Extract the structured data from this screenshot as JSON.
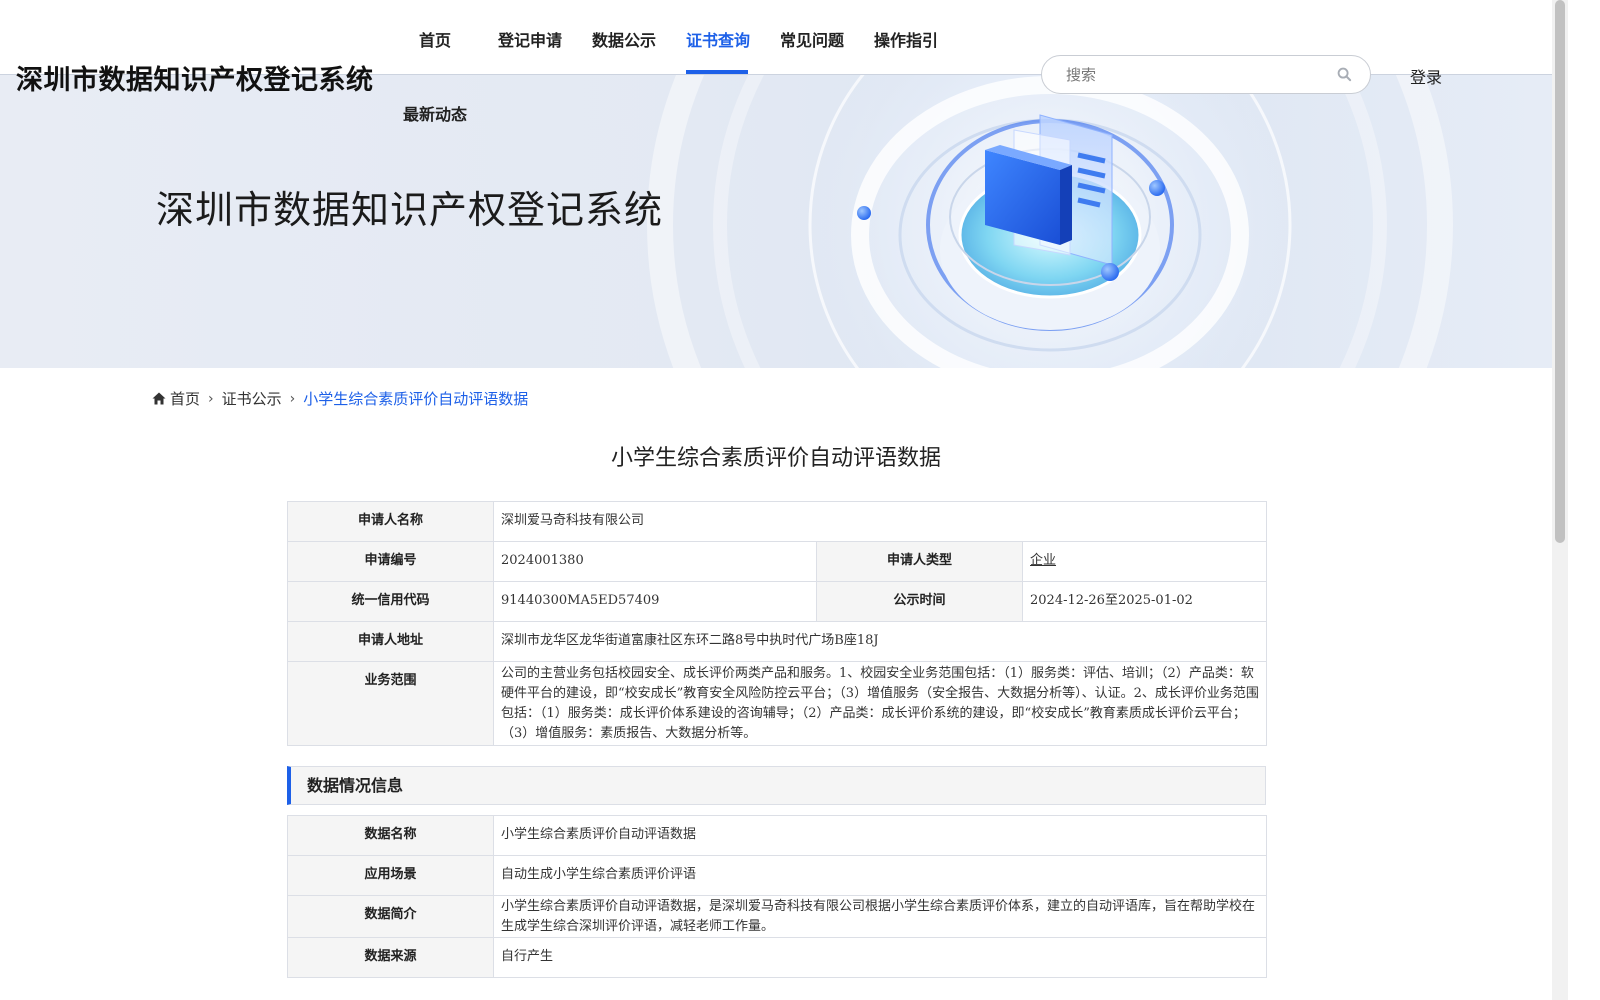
{
  "header": {
    "site_title": "深圳市数据知识产权登记系统",
    "nav": [
      {
        "label": "首页"
      },
      {
        "label": "登记申请"
      },
      {
        "label": "数据公示"
      },
      {
        "label": "证书查询",
        "active": true
      },
      {
        "label": "常见问题"
      },
      {
        "label": "操作指引"
      },
      {
        "label": "最新动态"
      }
    ],
    "search_placeholder": "搜索",
    "search_icon": "search-icon",
    "login_label": "登录"
  },
  "banner": {
    "title": "深圳市数据知识产权登记系统"
  },
  "breadcrumb": {
    "home_icon": "home-icon",
    "home": "首页",
    "parent": "证书公示",
    "current": "小学生综合素质评价自动评语数据"
  },
  "page_title": "小学生综合素质评价自动评语数据",
  "applicant": {
    "name_label": "申请人名称",
    "name": "深圳爱马奇科技有限公司",
    "number_label": "申请编号",
    "number": "2024001380",
    "type_label": "申请人类型",
    "type": "企业",
    "credit_label": "统一信用代码",
    "credit": "91440300MA5ED57409",
    "publish_label": "公示时间",
    "publish": "2024-12-26至2025-01-02",
    "address_label": "申请人地址",
    "address": "深圳市龙华区龙华街道富康社区东环二路8号中执时代广场B座18J",
    "scope_label": "业务范围",
    "scope": "公司的主营业务包括校园安全、成长评价两类产品和服务。1、校园安全业务范围包括：（1）服务类：评估、培训；（2）产品类：软硬件平台的建设，即“校安成长”教育安全风险防控云平台；（3）增值服务（安全报告、大数据分析等）、认证。2、成长评价业务范围包括：（1）服务类：成长评价体系建设的咨询辅导；（2）产品类：成长评价系统的建设，即“校安成长”教育素质成长评价云平台；（3）增值服务：素质报告、大数据分析等。"
  },
  "data_section": {
    "title": "数据情况信息",
    "name_label": "数据名称",
    "name": "小学生综合素质评价自动评语数据",
    "scene_label": "应用场景",
    "scene": "自动生成小学生综合素质评价评语",
    "intro_label": "数据简介",
    "intro": "小学生综合素质评价自动评语数据，是深圳爱马奇科技有限公司根据小学生综合素质评价体系，建立的自动评语库，旨在帮助学校在生成学生综合深圳评价评语，减轻老师工作量。",
    "source_label": "数据来源",
    "source": "自行产生"
  },
  "colors": {
    "accent": "#1d60e8",
    "label_bg": "#f5f5f5",
    "border": "#dcdfe6"
  }
}
